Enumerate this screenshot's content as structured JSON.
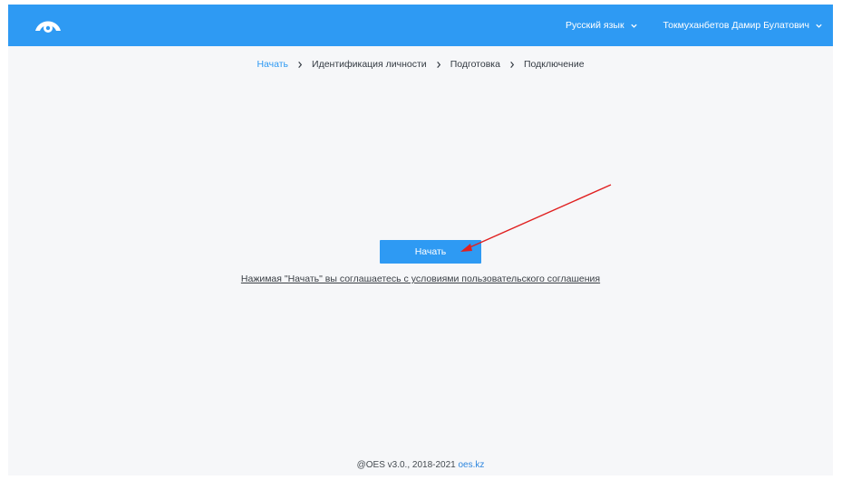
{
  "header": {
    "logo_icon": "eye-logo-icon",
    "language_label": "Русский язык",
    "user_label": "Токмуханбетов Дамир Булатович",
    "accent_color": "#2e9af3"
  },
  "breadcrumb": {
    "steps": [
      "Начать",
      "Идентификация личности",
      "Подготовка",
      "Подключение"
    ]
  },
  "main": {
    "start_button_label": "Начать",
    "agreement_text": "Нажимая \"Начать\" вы соглашаетесь с условиями пользовательского соглашения"
  },
  "footer": {
    "copyright": "@OES v3.0., 2018-2021",
    "link_text": "oes.kz"
  }
}
